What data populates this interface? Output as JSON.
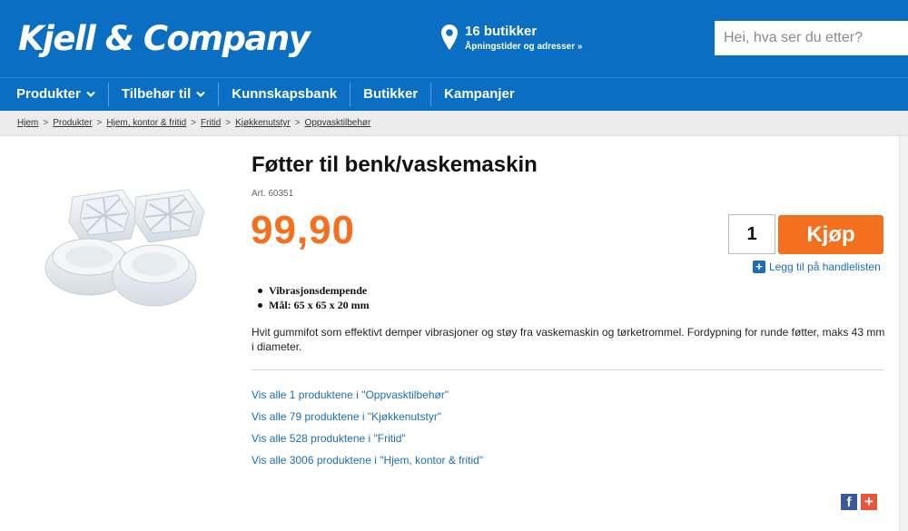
{
  "header": {
    "logo": "Kjell & Company",
    "stores_count": "16 butikker",
    "stores_sub": "Åpningstider og adresser »",
    "search_placeholder": "Hei, hva ser du etter?"
  },
  "nav": {
    "items": [
      {
        "label": "Produkter",
        "dropdown": true
      },
      {
        "label": "Tilbehør til",
        "dropdown": true
      },
      {
        "label": "Kunnskapsbank",
        "dropdown": false
      },
      {
        "label": "Butikker",
        "dropdown": false
      },
      {
        "label": "Kampanjer",
        "dropdown": false
      }
    ]
  },
  "breadcrumb": [
    "Hjem",
    "Produkter",
    "Hjem, kontor & fritid",
    "Fritid",
    "Kjøkkenutstyr",
    "Oppvasktilbehør"
  ],
  "product": {
    "title": "Føtter til benk/vaskemaskin",
    "art": "Art. 60351",
    "price": "99,90",
    "quantity": "1",
    "buy_label": "Kjøp",
    "add_to_list": "Legg til på handlelisten",
    "bullets": [
      "Vibrasjonsdempende",
      "Mål: 65 x 65 x 20 mm"
    ],
    "description": "Hvit gummifot som effektivt demper vibrasjoner og støy fra vaskemaskin og tørketrommel. Fordypning for runde føtter, maks 43 mm i diameter."
  },
  "category_links": [
    "Vis alle 1 produktene i \"Oppvasktilbehør\"",
    "Vis alle 79 produktene i \"Kjøkkenutstyr\"",
    "Vis alle 528 produktene i \"Fritid\"",
    "Vis alle 3006 produktene i \"Hjem, kontor & fritid\""
  ],
  "share": {
    "facebook": "f",
    "plus": "+"
  },
  "colors": {
    "brand_blue": "#0a6fc2",
    "accent_orange": "#f4701f",
    "link_blue": "#1a6fb8"
  }
}
